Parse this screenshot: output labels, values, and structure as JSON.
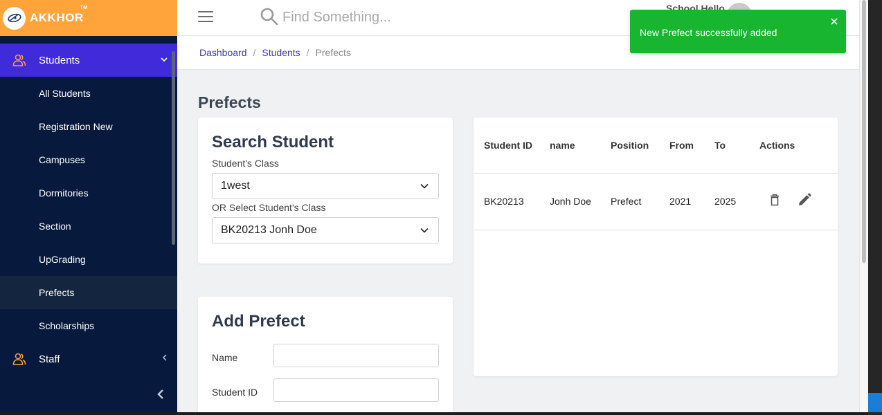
{
  "brand": {
    "name": "AKKHOR",
    "trademark": "TM"
  },
  "sidebar": {
    "parents": [
      {
        "label": "Students",
        "icon": "users-icon",
        "expanded": true
      },
      {
        "label": "Staff",
        "icon": "users-icon",
        "expanded": false
      }
    ],
    "children": [
      {
        "label": "All Students"
      },
      {
        "label": "Registration New"
      },
      {
        "label": "Campuses"
      },
      {
        "label": "Dormitories"
      },
      {
        "label": "Section"
      },
      {
        "label": "UpGrading"
      },
      {
        "label": "Prefects"
      },
      {
        "label": "Scholarships"
      }
    ],
    "active_child": "Prefects"
  },
  "header": {
    "search_placeholder": "Find Something...",
    "user_name": "School Hello"
  },
  "breadcrumb": {
    "items": [
      "Dashboard",
      "Students",
      "Prefects"
    ]
  },
  "page": {
    "title": "Prefects"
  },
  "search_card": {
    "title": "Search Student",
    "class_label": "Student's Class",
    "class_value": "1west",
    "student_label": "OR Select Student's Class",
    "student_value": "BK20213 Jonh Doe"
  },
  "add_card": {
    "title": "Add Prefect",
    "name_label": "Name",
    "name_value": "",
    "student_id_label": "Student ID",
    "student_id_value": ""
  },
  "table": {
    "headers": [
      "Student ID",
      "name",
      "Position",
      "From",
      "To",
      "Actions"
    ],
    "rows": [
      {
        "student_id": "BK20213",
        "name": "Jonh Doe",
        "position": "Prefect",
        "from": "2021",
        "to": "2025"
      }
    ]
  },
  "toast": {
    "message": "New Prefect successfully added"
  },
  "colors": {
    "brand_orange": "#ffa43a",
    "sidebar_bg": "#071a3d",
    "active_purple": "#3f2bd9",
    "toast_green": "#17b530",
    "link_blue": "#3b37c8"
  }
}
